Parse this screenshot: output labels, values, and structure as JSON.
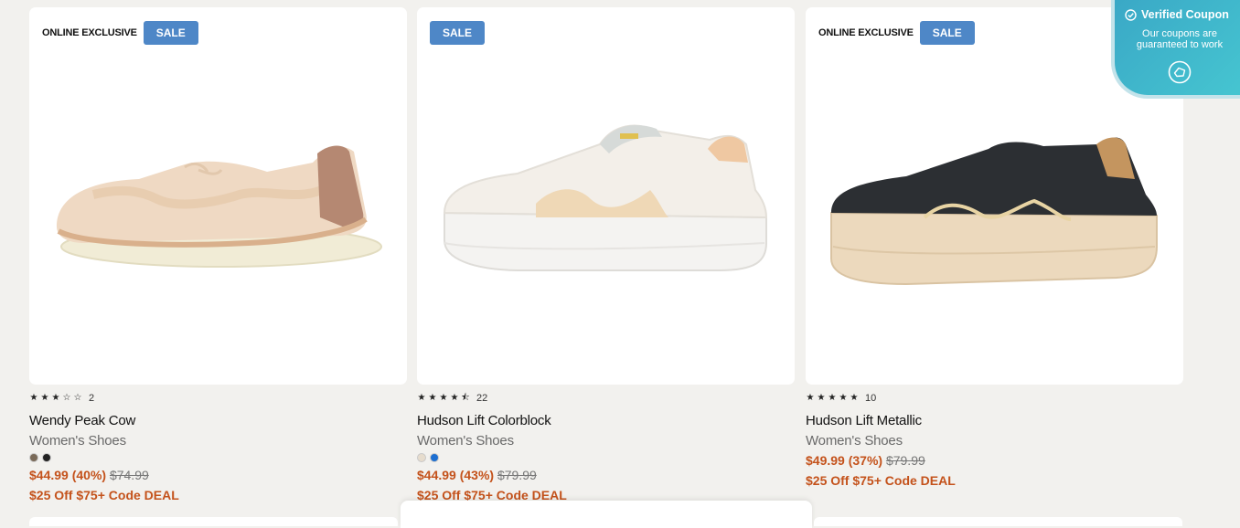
{
  "products": [
    {
      "badges": {
        "online": "ONLINE EXCLUSIVE",
        "sale": "SALE"
      },
      "rating": {
        "stars": [
          "★",
          "★",
          "★",
          "☆",
          "☆"
        ],
        "count": "2"
      },
      "title": "Wendy Peak Cow",
      "category": "Women's Shoes",
      "swatches": [
        "#7a6a58",
        "#222222"
      ],
      "price": {
        "sale": "$44.99 (40%)",
        "original": "$74.99"
      },
      "deal": "$25 Off $75+ Code DEAL"
    },
    {
      "badges": {
        "online": "",
        "sale": "SALE"
      },
      "rating": {
        "stars": [
          "★",
          "★",
          "★",
          "★",
          "⯪"
        ],
        "count": "22"
      },
      "title": "Hudson Lift Colorblock",
      "category": "Women's Shoes",
      "swatches": [
        "#e6dccd",
        "#1d6fd1"
      ],
      "price": {
        "sale": "$44.99 (43%)",
        "original": "$79.99"
      },
      "deal": "$25 Off $75+ Code DEAL"
    },
    {
      "badges": {
        "online": "ONLINE EXCLUSIVE",
        "sale": "SALE"
      },
      "rating": {
        "stars": [
          "★",
          "★",
          "★",
          "★",
          "★"
        ],
        "count": "10"
      },
      "title": "Hudson Lift Metallic",
      "category": "Women's Shoes",
      "swatches": [],
      "price": {
        "sale": "$49.99 (37%)",
        "original": "$79.99"
      },
      "deal": "$25 Off $75+ Code DEAL"
    }
  ],
  "coupon": {
    "title": "Verified Coupon",
    "subtitle": "Our coupons are guaranteed to work",
    "icon": "coupon-chat-icon"
  },
  "colors": {
    "sale_badge": "#4e87c7",
    "price": "#c4521b",
    "background": "#f2f1ee"
  }
}
